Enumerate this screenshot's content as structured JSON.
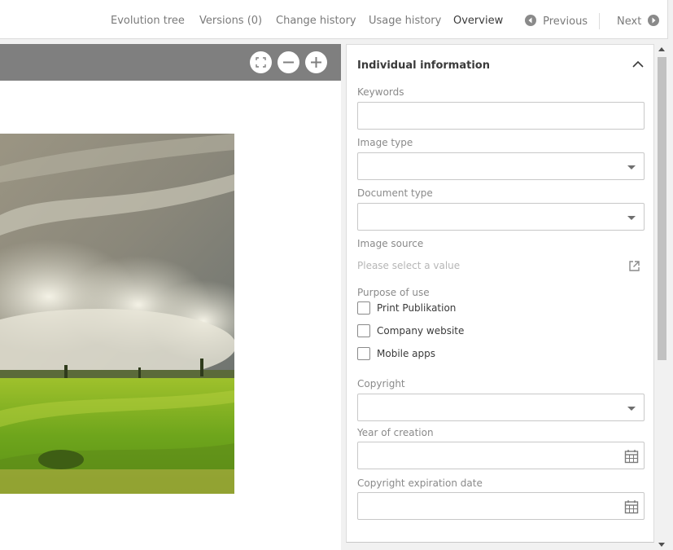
{
  "nav": {
    "evolution_tree": "Evolution tree",
    "versions": "Versions (0)",
    "change_history": "Change history",
    "usage_history": "Usage history",
    "overview": "Overview",
    "previous": "Previous",
    "next": "Next"
  },
  "viewer": {
    "tools": [
      "fullscreen-icon",
      "zoom-out-icon",
      "zoom-in-icon"
    ]
  },
  "panel": {
    "title": "Individual information",
    "keywords_label": "Keywords",
    "keywords_value": "",
    "image_type_label": "Image type",
    "image_type_value": "",
    "document_type_label": "Document type",
    "document_type_value": "",
    "image_source_label": "Image source",
    "image_source_placeholder": "Please select a value",
    "purpose_label": "Purpose of use",
    "purposes": [
      "Print Publikation",
      "Company website",
      "Mobile apps"
    ],
    "copyright_label": "Copyright",
    "copyright_value": "",
    "year_label": "Year of creation",
    "year_value": "",
    "expiration_label": "Copyright expiration date",
    "expiration_value": ""
  },
  "colors": {
    "toolbar": "#7f7f7f",
    "accent_text": "#3a3a3a",
    "muted_text": "#8a8a8a"
  }
}
